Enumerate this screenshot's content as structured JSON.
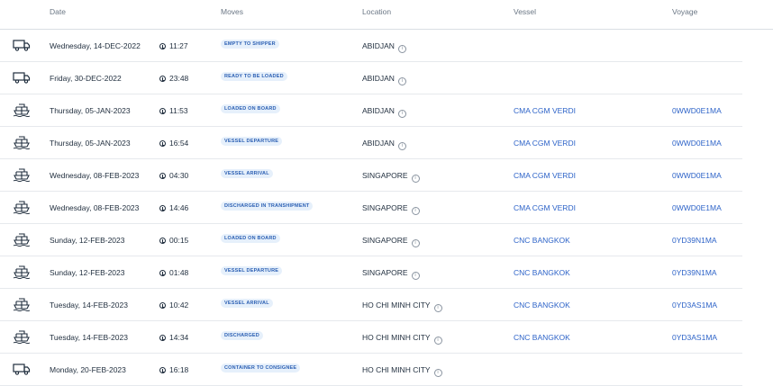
{
  "headers": {
    "date": "Date",
    "moves": "Moves",
    "location": "Location",
    "vessel": "Vessel",
    "voyage": "Voyage"
  },
  "rows": [
    {
      "icon": "truck-icon",
      "date": "Wednesday, 14-DEC-2022",
      "time": "11:27",
      "move": "EMPTY TO SHIPPER",
      "location": "ABIDJAN",
      "vessel": "",
      "voyage": ""
    },
    {
      "icon": "truck-icon",
      "date": "Friday, 30-DEC-2022",
      "time": "23:48",
      "move": "READY TO BE LOADED",
      "location": "ABIDJAN",
      "vessel": "",
      "voyage": ""
    },
    {
      "icon": "ship-icon",
      "date": "Thursday, 05-JAN-2023",
      "time": "11:53",
      "move": "LOADED ON BOARD",
      "location": "ABIDJAN",
      "vessel": "CMA CGM VERDI",
      "voyage": "0WWD0E1MA"
    },
    {
      "icon": "ship-icon",
      "date": "Thursday, 05-JAN-2023",
      "time": "16:54",
      "move": "VESSEL DEPARTURE",
      "location": "ABIDJAN",
      "vessel": "CMA CGM VERDI",
      "voyage": "0WWD0E1MA"
    },
    {
      "icon": "ship-icon",
      "date": "Wednesday, 08-FEB-2023",
      "time": "04:30",
      "move": "VESSEL ARRIVAL",
      "location": "SINGAPORE",
      "vessel": "CMA CGM VERDI",
      "voyage": "0WWD0E1MA"
    },
    {
      "icon": "ship-icon",
      "date": "Wednesday, 08-FEB-2023",
      "time": "14:46",
      "move": "DISCHARGED IN TRANSHIPMENT",
      "location": "SINGAPORE",
      "vessel": "CMA CGM VERDI",
      "voyage": "0WWD0E1MA"
    },
    {
      "icon": "ship-icon",
      "date": "Sunday, 12-FEB-2023",
      "time": "00:15",
      "move": "LOADED ON BOARD",
      "location": "SINGAPORE",
      "vessel": "CNC BANGKOK",
      "voyage": "0YD39N1MA"
    },
    {
      "icon": "ship-icon",
      "date": "Sunday, 12-FEB-2023",
      "time": "01:48",
      "move": "VESSEL DEPARTURE",
      "location": "SINGAPORE",
      "vessel": "CNC BANGKOK",
      "voyage": "0YD39N1MA"
    },
    {
      "icon": "ship-icon",
      "date": "Tuesday, 14-FEB-2023",
      "time": "10:42",
      "move": "VESSEL ARRIVAL",
      "location": "HO CHI MINH CITY",
      "vessel": "CNC BANGKOK",
      "voyage": "0YD3AS1MA"
    },
    {
      "icon": "ship-icon",
      "date": "Tuesday, 14-FEB-2023",
      "time": "14:34",
      "move": "DISCHARGED",
      "location": "HO CHI MINH CITY",
      "vessel": "CNC BANGKOK",
      "voyage": "0YD3AS1MA"
    },
    {
      "icon": "truck-icon",
      "date": "Monday, 20-FEB-2023",
      "time": "16:18",
      "move": "CONTAINER TO CONSIGNEE",
      "location": "HO CHI MINH CITY",
      "vessel": "",
      "voyage": ""
    }
  ]
}
